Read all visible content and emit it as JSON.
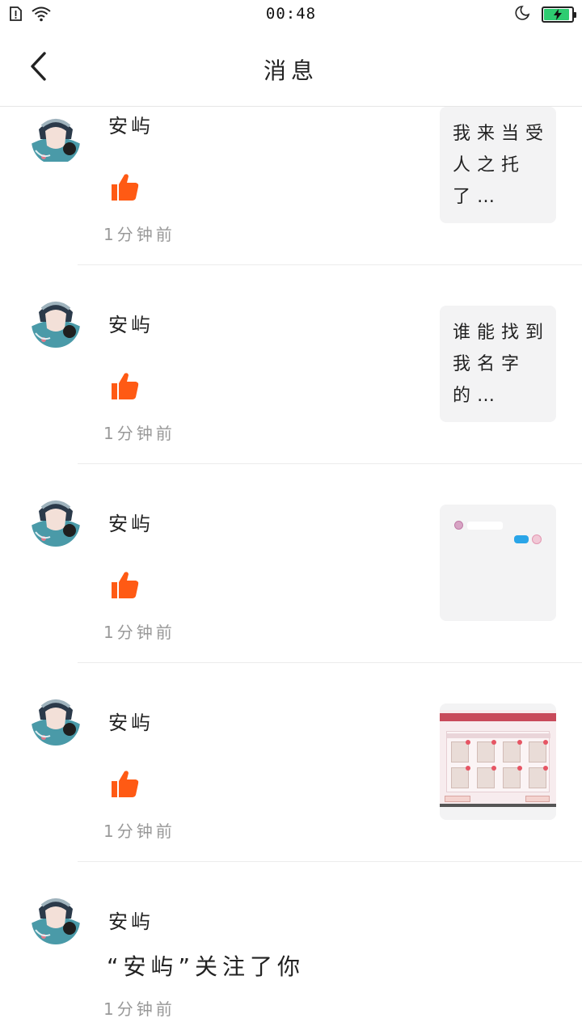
{
  "status_bar": {
    "time": "00:48",
    "battery_level": 0.9,
    "battery_color": "#2ecc71",
    "icons": [
      "sim-alert-icon",
      "wifi-icon",
      "moon-icon",
      "battery-charging-icon"
    ]
  },
  "nav": {
    "title": "消息",
    "back_icon": "chevron-left-icon"
  },
  "colors": {
    "like": "#ff5a14",
    "divider": "#ececec",
    "card_bg": "#f3f3f4",
    "time_text": "#999999"
  },
  "messages": [
    {
      "username": "安屿",
      "type": "like",
      "time": "1分钟前",
      "preview_kind": "text",
      "preview_text": "我来当受人之托了…"
    },
    {
      "username": "安屿",
      "type": "like",
      "time": "1分钟前",
      "preview_kind": "text",
      "preview_text": "谁能找到我名字的…"
    },
    {
      "username": "安屿",
      "type": "like",
      "time": "1分钟前",
      "preview_kind": "chat-screenshot",
      "preview_text": ""
    },
    {
      "username": "安屿",
      "type": "like",
      "time": "1分钟前",
      "preview_kind": "game-screenshot",
      "preview_text": ""
    },
    {
      "username": "安屿",
      "type": "follow",
      "time": "1分钟前",
      "follow_text": "“安屿”关注了你"
    }
  ]
}
